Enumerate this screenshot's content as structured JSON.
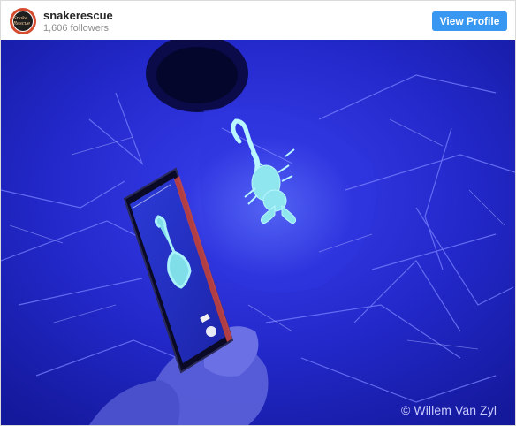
{
  "profile": {
    "username": "snakerescue",
    "followers": "1,606 followers",
    "view_profile_label": "View Profile",
    "avatar_icon": "snake-rescue-logo",
    "avatar_text": "Snake Rescue"
  },
  "photo": {
    "credit": "© Willem Van Zyl"
  },
  "colors": {
    "accent": "#3897f0",
    "uv_blue": "#1a1fb0",
    "scorpion_glow": "#9fe9f0"
  }
}
